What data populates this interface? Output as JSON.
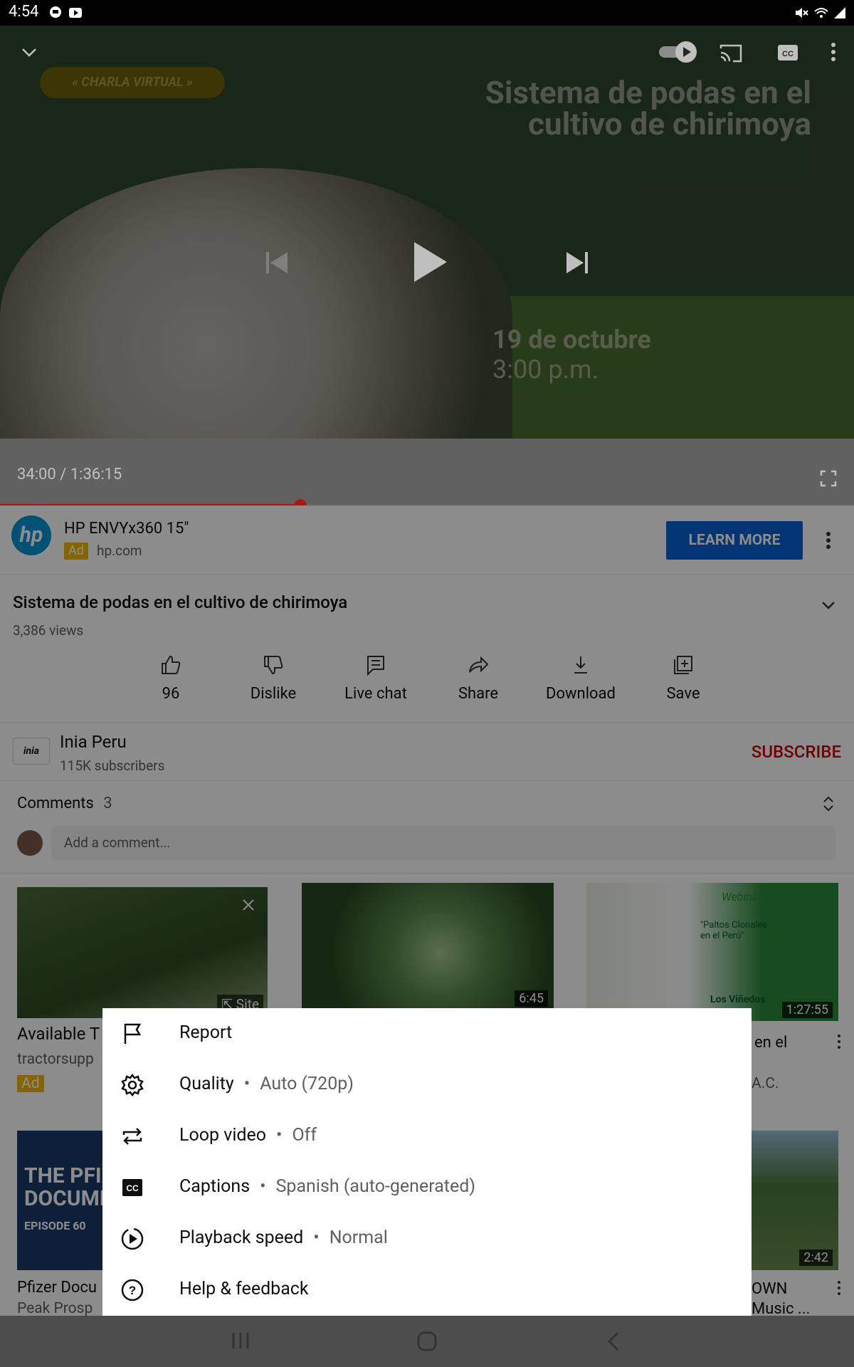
{
  "status_bar": {
    "time": "4:54"
  },
  "player": {
    "tag": "« CHARLA VIRTUAL »",
    "slide_title": "Sistema de podas en el cultivo de chirimoya",
    "slide_date": "19 de octubre",
    "slide_time": "3:00 p.m.",
    "timecode": "34:00 / 1:36:15",
    "progress": 0.352
  },
  "ad": {
    "title": "HP ENVYx360 15\"",
    "badge": "Ad",
    "domain": "hp.com",
    "cta": "LEARN MORE"
  },
  "video": {
    "title": "Sistema de podas en el cultivo de chirimoya",
    "views": "3,386 views"
  },
  "actions": [
    {
      "label": "96",
      "icon": "thumbs-up-icon"
    },
    {
      "label": "Dislike",
      "icon": "thumbs-down-icon"
    },
    {
      "label": "Live chat",
      "icon": "live-chat-icon"
    },
    {
      "label": "Share",
      "icon": "share-icon"
    },
    {
      "label": "Download",
      "icon": "download-icon"
    },
    {
      "label": "Save",
      "icon": "save-icon"
    }
  ],
  "channel": {
    "name": "Inia Peru",
    "subscribers": "115K subscribers",
    "subscribe": "SUBSCRIBE"
  },
  "comments": {
    "label": "Comments",
    "count": "3",
    "placeholder": "Add a comment..."
  },
  "recommendations": {
    "r1": {
      "title": "Available T",
      "channel": "tractorsupp",
      "badge": "Ad",
      "site": "Site"
    },
    "r2": {
      "duration": "6:45"
    },
    "r3": {
      "thumb_text": "Webinar libre",
      "thumb_sub": "\"Paltos Clonales en el Perú\"",
      "thumb_brand": "Los Viñedos",
      "duration": "1:27:55",
      "title_end": "en el",
      "channel_end": "A.C."
    },
    "r4": {
      "title": "Pfizer Docu",
      "channel": "Peak Prosp",
      "thumb_text": "THE PFIZER DOCUMENTS",
      "thumb_sub": "EPISODE 60"
    },
    "r5": {
      "duration": "2:42",
      "title_end": "OWN",
      "channel_end": "Music ..."
    }
  },
  "menu": [
    {
      "label": "Report",
      "value": "",
      "icon": "flag-icon"
    },
    {
      "label": "Quality",
      "value": "Auto (720p)",
      "icon": "gear-icon"
    },
    {
      "label": "Loop video",
      "value": "Off",
      "icon": "loop-icon"
    },
    {
      "label": "Captions",
      "value": "Spanish (auto-generated)",
      "icon": "captions-icon"
    },
    {
      "label": "Playback speed",
      "value": "Normal",
      "icon": "playback-speed-icon"
    },
    {
      "label": "Help & feedback",
      "value": "",
      "icon": "help-icon"
    }
  ],
  "colors": {
    "accent": "#e62117",
    "link": "#065fd4",
    "ad_badge": "#f2b804"
  }
}
